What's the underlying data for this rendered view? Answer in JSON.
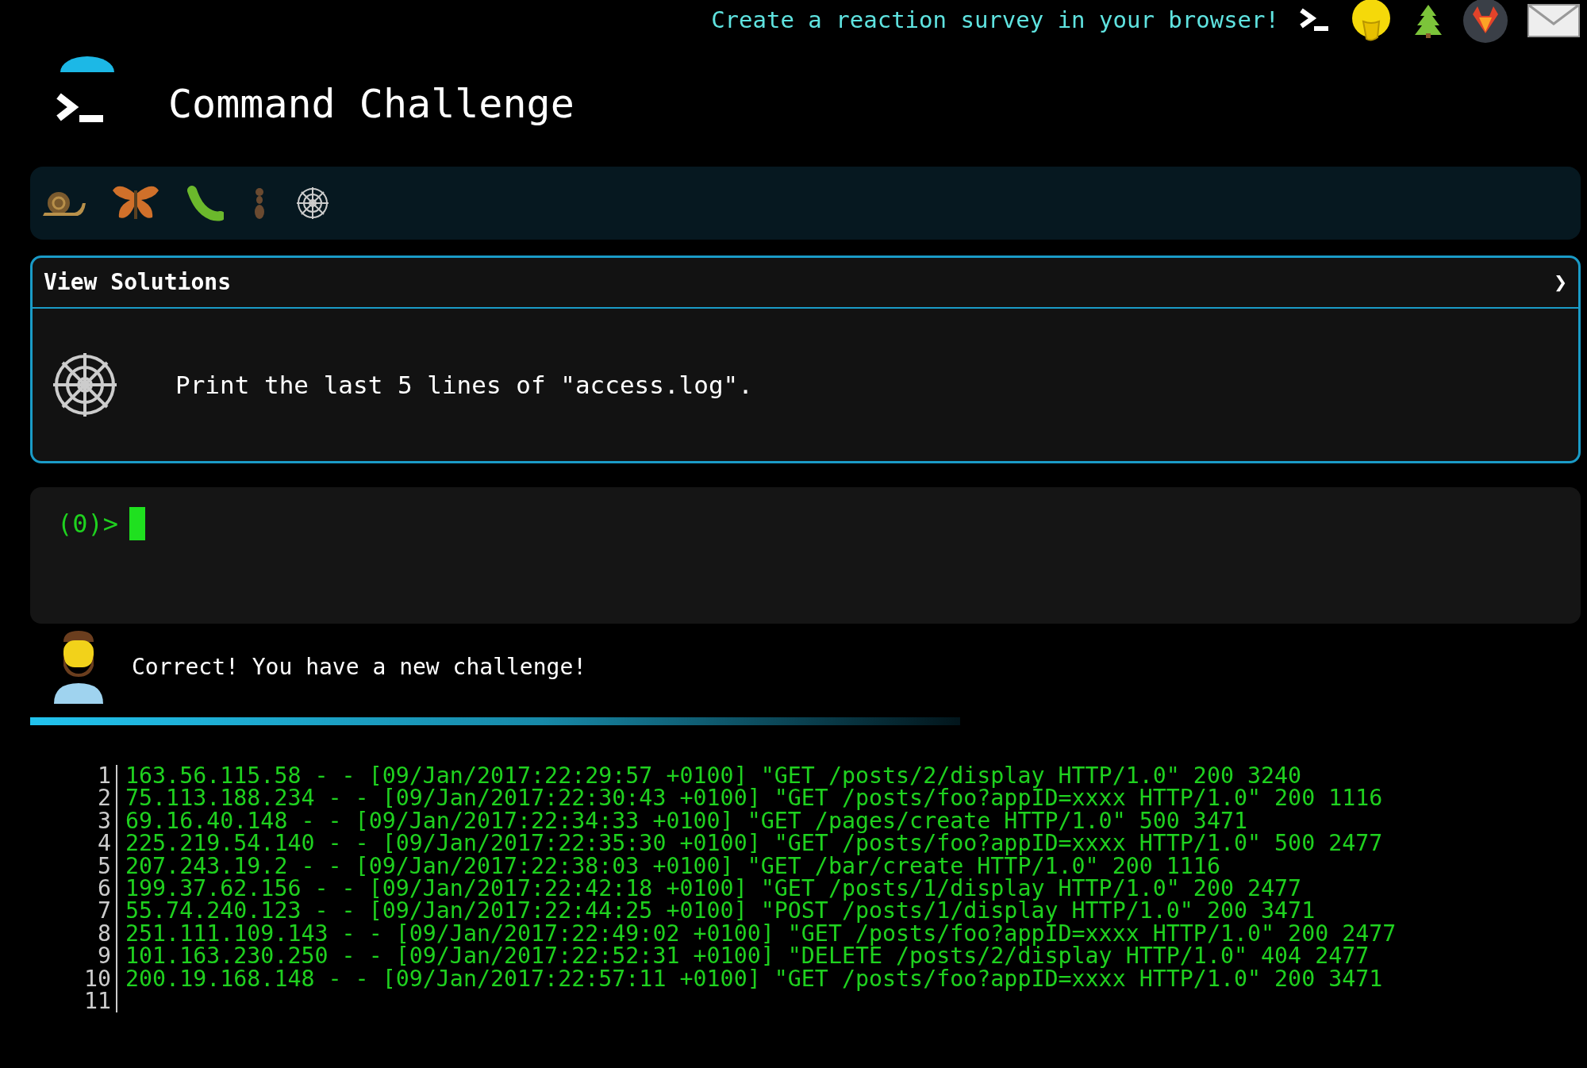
{
  "banner": {
    "text": "Create a reaction survey in your browser!",
    "icons": [
      {
        "kind": "prompt"
      },
      {
        "kind": "face"
      },
      {
        "kind": "tree"
      },
      {
        "kind": "fox"
      },
      {
        "kind": "mail"
      }
    ]
  },
  "header": {
    "title": "Command Challenge"
  },
  "badges": [
    {
      "kind": "snail"
    },
    {
      "kind": "butterfly"
    },
    {
      "kind": "caterpillar"
    },
    {
      "kind": "ant"
    },
    {
      "kind": "web"
    }
  ],
  "solutions": {
    "label": "View Solutions",
    "chevron": "❯",
    "challenge": "Print the last 5 lines of \"access.log\"."
  },
  "terminal": {
    "prompt": "(0)>"
  },
  "message": {
    "text": "Correct! You have a new challenge!"
  },
  "log": [
    {
      "number": "1",
      "text": "163.56.115.58 - - [09/Jan/2017:22:29:57 +0100] \"GET /posts/2/display HTTP/1.0\" 200 3240"
    },
    {
      "number": "2",
      "text": "75.113.188.234 - - [09/Jan/2017:22:30:43 +0100] \"GET /posts/foo?appID=xxxx HTTP/1.0\" 200 1116"
    },
    {
      "number": "3",
      "text": "69.16.40.148 - - [09/Jan/2017:22:34:33 +0100] \"GET /pages/create HTTP/1.0\" 500 3471"
    },
    {
      "number": "4",
      "text": "225.219.54.140 - - [09/Jan/2017:22:35:30 +0100] \"GET /posts/foo?appID=xxxx HTTP/1.0\" 500 2477"
    },
    {
      "number": "5",
      "text": "207.243.19.2 - - [09/Jan/2017:22:38:03 +0100] \"GET /bar/create HTTP/1.0\" 200 1116"
    },
    {
      "number": "6",
      "text": "199.37.62.156 - - [09/Jan/2017:22:42:18 +0100] \"GET /posts/1/display HTTP/1.0\" 200 2477"
    },
    {
      "number": "7",
      "text": "55.74.240.123 - - [09/Jan/2017:22:44:25 +0100] \"POST /posts/1/display HTTP/1.0\" 200 3471"
    },
    {
      "number": "8",
      "text": "251.111.109.143 - - [09/Jan/2017:22:49:02 +0100] \"GET /posts/foo?appID=xxxx HTTP/1.0\" 200 2477"
    },
    {
      "number": "9",
      "text": "101.163.230.250 - - [09/Jan/2017:22:52:31 +0100] \"DELETE /posts/2/display HTTP/1.0\" 404 2477"
    },
    {
      "number": "10",
      "text": "200.19.168.148 - - [09/Jan/2017:22:57:11 +0100] \"GET /posts/foo?appID=xxxx HTTP/1.0\" 200 3471"
    },
    {
      "number": "11"
    }
  ]
}
